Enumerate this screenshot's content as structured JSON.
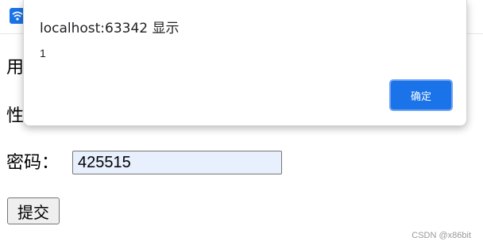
{
  "form": {
    "username_label": "用户名：",
    "gender_label": "性别：",
    "password_label": "密码：",
    "password_value": "425515",
    "submit_label": "提交"
  },
  "dialog": {
    "title": "localhost:63342 显示",
    "message": "1",
    "confirm_label": "确定"
  },
  "watermark": "CSDN @x86bit",
  "colors": {
    "accent": "#1a73e8",
    "input_autofill_bg": "#e8f0fe"
  },
  "icons": {
    "tab_favicon": "wifi-icon"
  }
}
